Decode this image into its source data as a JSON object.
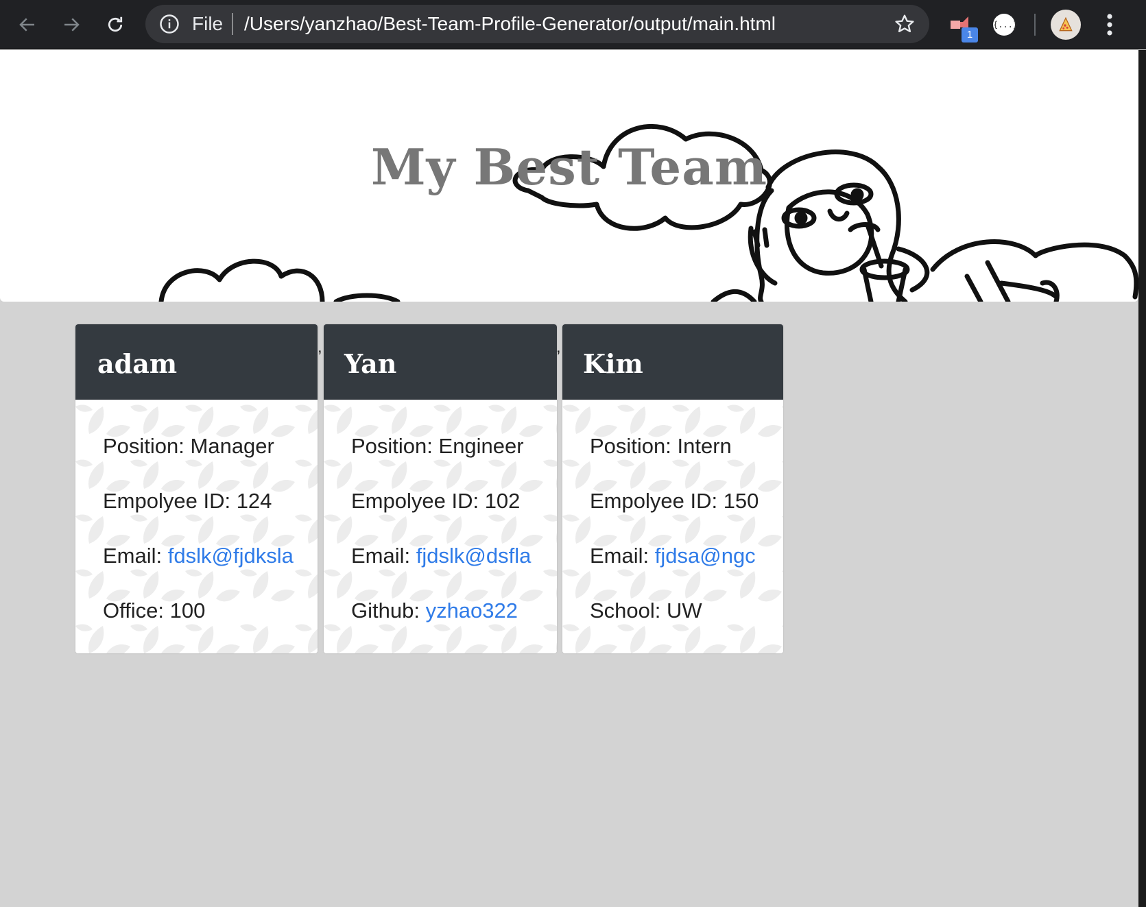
{
  "browser": {
    "omnibox_scheme": "File",
    "url": "/Users/yanzhao/Best-Team-Profile-Generator/output/main.html",
    "extension_badge": "1",
    "extension2_label": "{...}"
  },
  "page": {
    "title": "My Best Team",
    "separator": ","
  },
  "team": [
    {
      "name": "adam",
      "position_label": "Position: Manager",
      "id_label": "Empolyee ID: 124",
      "email_prefix": "Email: ",
      "email": "fdslk@fjdksla",
      "extra_prefix": "Office: 100",
      "extra_link": ""
    },
    {
      "name": "Yan",
      "position_label": "Position: Engineer",
      "id_label": "Empolyee ID: 102",
      "email_prefix": "Email: ",
      "email": "fjdslk@dsfla",
      "extra_prefix": "Github: ",
      "extra_link": "yzhao322"
    },
    {
      "name": "Kim",
      "position_label": "Position: Intern",
      "id_label": "Empolyee ID: 150",
      "email_prefix": "Email: ",
      "email": "fjdsa@ngc",
      "extra_prefix": "School: UW",
      "extra_link": ""
    }
  ],
  "colors": {
    "card_header_bg": "#343a40",
    "link": "#2f7be8",
    "page_bg": "#d3d3d3"
  }
}
